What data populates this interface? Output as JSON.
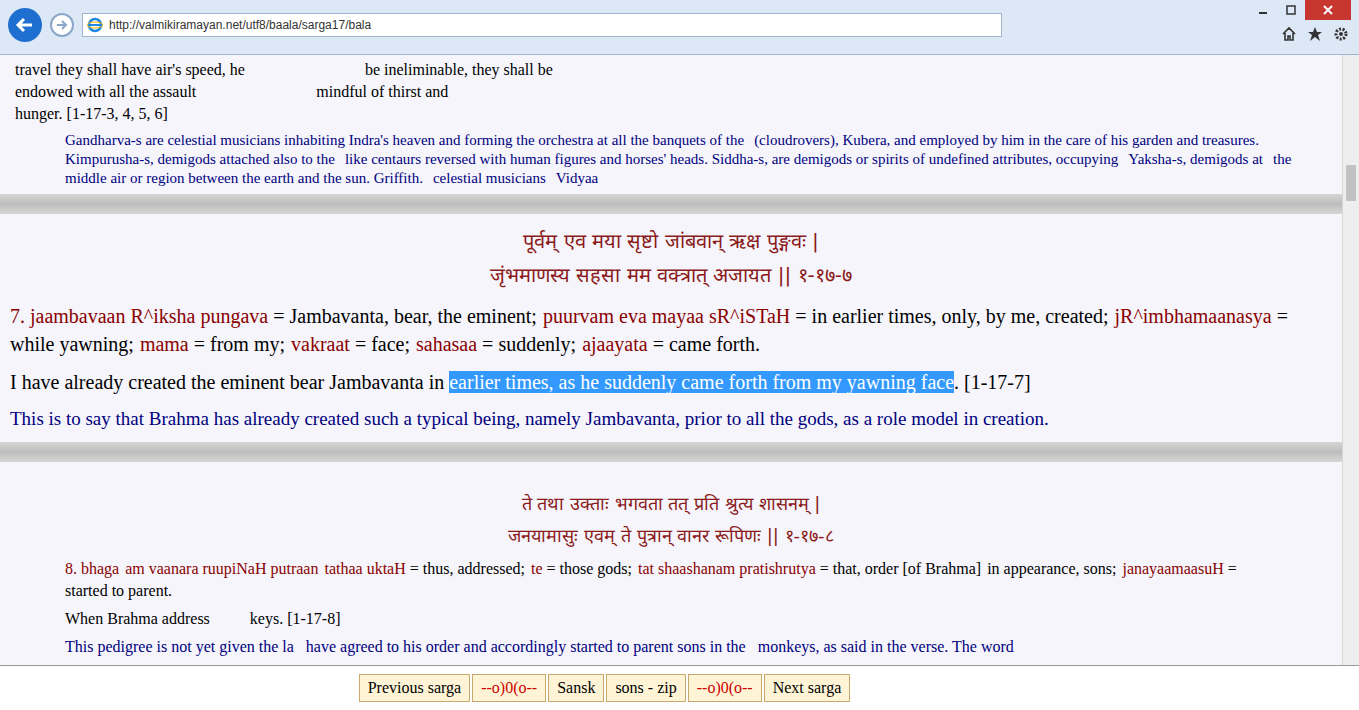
{
  "browser": {
    "url": "http://valmikiramayan.net/utf8/baala/sarga17/bala"
  },
  "intro": {
    "lines": [
      [
        "travel they shall have air's speed, he",
        "be ineliminable, they shall be"
      ],
      [
        "endowed with all the assault",
        "mindful of thirst and"
      ],
      [
        "hunger. [1-17-3, 4, 5, 6]"
      ]
    ],
    "note": [
      "Gandharva-s are celestial musicians inhabiting Indra's heaven and forming the orchestra at all the banquets of the",
      "(cloudrovers), Kubera, and employed by him in the care of his garden and treasures. Kimpurusha-s, demigods attached also to the",
      "like centaurs reversed with human figures and horses' heads. Siddha-s, are demigods or spirits of undefined attributes, occupying",
      "Yaksha-s, demigods at",
      "the middle air or region between the earth and the sun. Griffith.",
      "celestial musicians",
      "Vidyaa"
    ]
  },
  "verses": [
    {
      "sanskrit": [
        "पूर्वम् एव मया सृष्टो जांबवान् ऋक्ष पुङ्गवः |",
        "जृंभमाणस्य सहसा मम वक्त्रात् अजायत || १-१७-७"
      ],
      "gloss": [
        {
          "term": "7. jaambavaan R^iksha pungava",
          "meaning": "Jambavanta, bear, the eminent;"
        },
        {
          "term": "puurvam eva mayaa sR^iSTaH",
          "meaning": "in earlier times, only, by me, created;"
        },
        {
          "term": "jR^imbhamaanasya",
          "meaning": "while yawning;"
        },
        {
          "term": "mama",
          "meaning": "from my;"
        },
        {
          "term": "vakraat",
          "meaning": "face;"
        },
        {
          "term": "sahasaa",
          "meaning": "suddenly;"
        },
        {
          "term": "ajaayata",
          "meaning": "came forth."
        }
      ],
      "translation": {
        "before": "I have already created the eminent bear Jambavanta in ",
        "selected": "earlier times, as he suddenly came forth from my yawning face",
        "after": ". [1-17-7]"
      },
      "comment": [
        "This is to say that Brahma has already created such a typical being, namely Jambavanta, prior to all the gods, as a role model in creation."
      ],
      "magnified": true
    },
    {
      "sanskrit": [
        "ते तथा उक्ताः भगवता तत् प्रति श्रुत्य शासनम् |",
        "जनयामासुः एवम् ते पुत्रान् वानर रूपिणः || १-१७-८"
      ],
      "gloss": [
        {
          "term": "8. bhaga",
          "meaning": ""
        },
        {
          "term": "am vaanara ruupiNaH putraan",
          "meaning": ""
        },
        {
          "term": "tathaa uktaH",
          "meaning": "thus, addressed;"
        },
        {
          "term": "te",
          "meaning": "those gods;"
        },
        {
          "term": "tat shaashanam pratishrutya",
          "meaning": "that, order [of Brahma]"
        },
        {
          "term": "",
          "meaning": "in appearance, sons;"
        },
        {
          "term": "janayaamaasuH",
          "meaning": "started to parent."
        }
      ],
      "translation": {
        "before": "When Brahma address",
        "selected": "",
        "after": "keys. [1-17-8]"
      },
      "comment": [
        "This pedigree is not yet given the la",
        "have agreed to his order and accordingly started to parent sons in the",
        "monkeys, as said in the verse. The word"
      ],
      "magnified": false
    }
  ],
  "nav": [
    {
      "label": "Previous sarga",
      "kind": "link"
    },
    {
      "label": "--o)0(o--",
      "kind": "ornament"
    },
    {
      "label": "Sansk",
      "kind": "link"
    },
    {
      "label": "sons - zip",
      "kind": "link"
    },
    {
      "label": "--o)0(o--",
      "kind": "ornament"
    },
    {
      "label": "Next sarga",
      "kind": "link"
    }
  ]
}
